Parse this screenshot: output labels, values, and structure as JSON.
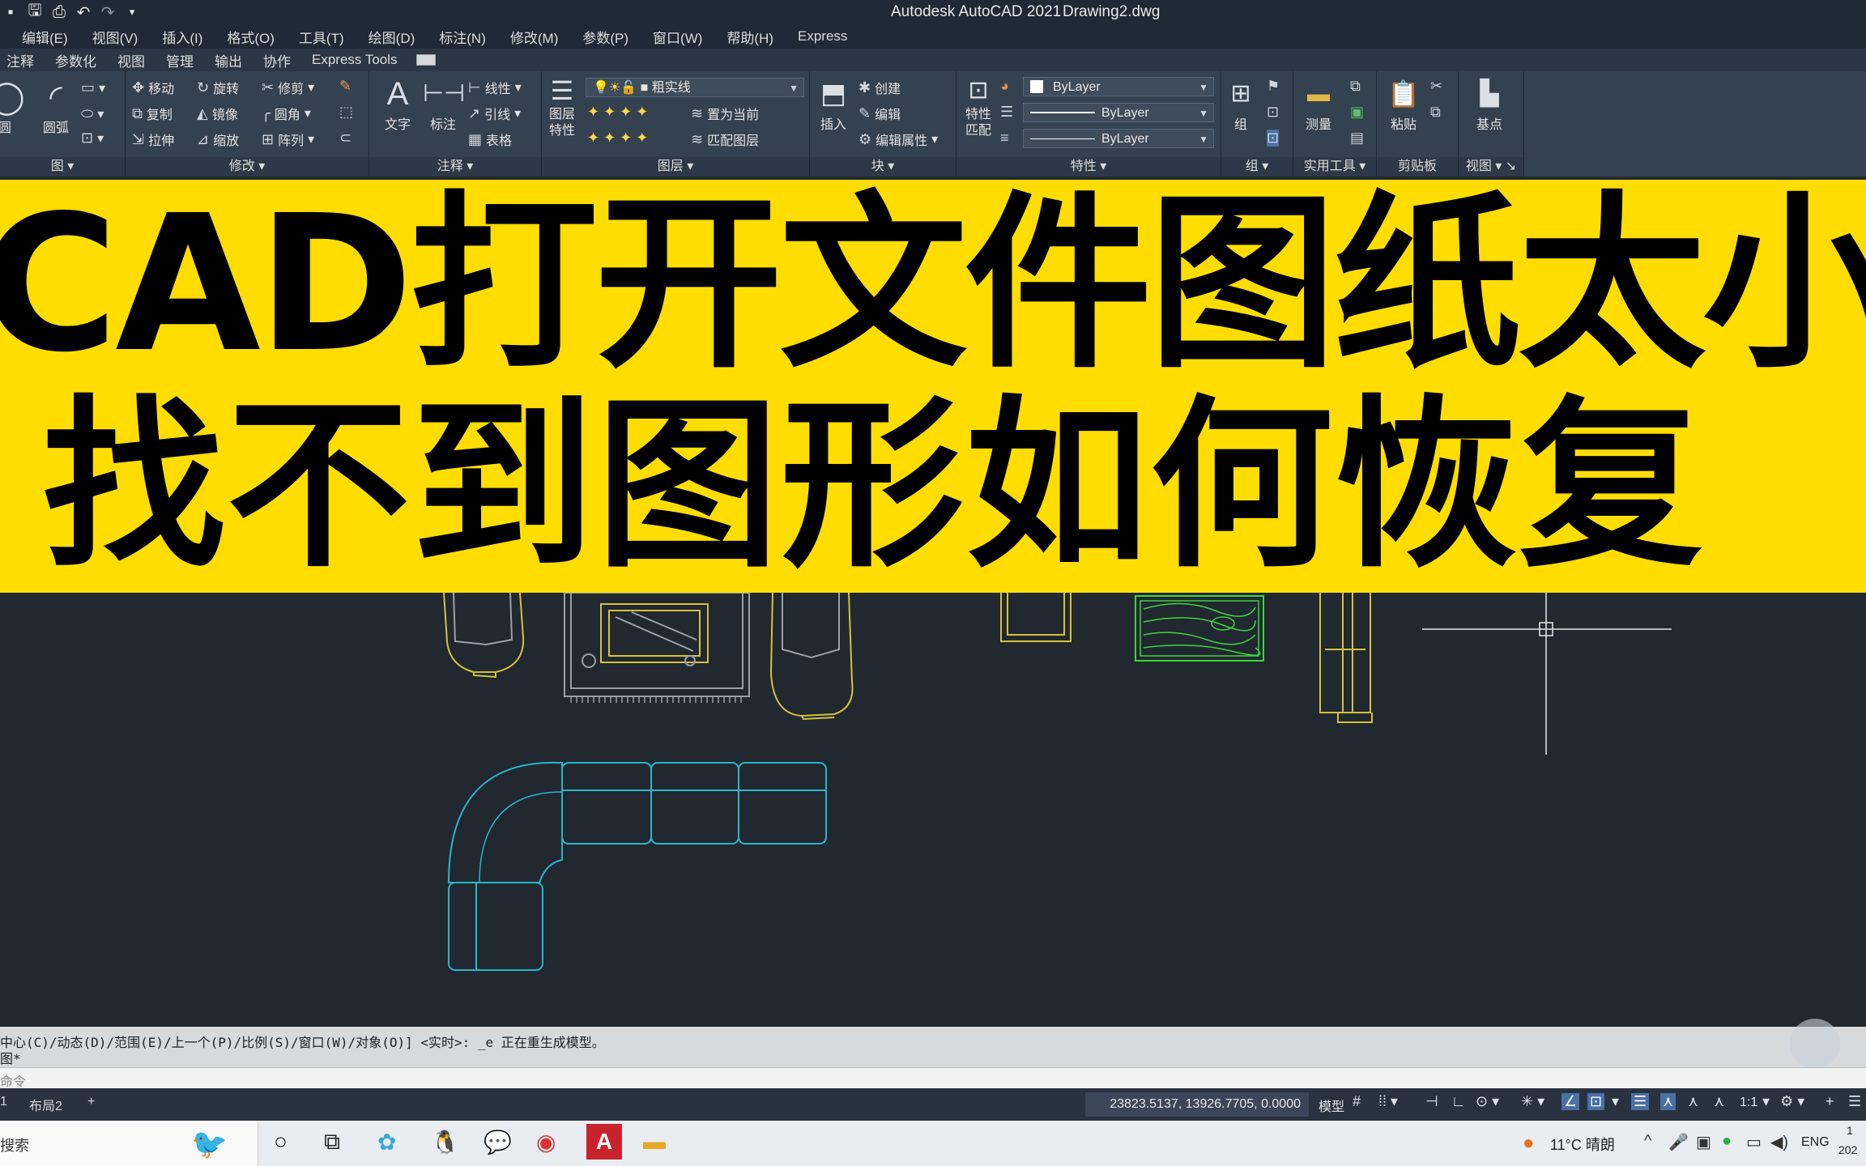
{
  "titlebar": {
    "app": "Autodesk AutoCAD 2021",
    "file": "Drawing2.dwg"
  },
  "qat_icons": [
    "file-save-icon",
    "save-as-icon",
    "print-icon",
    "undo-icon",
    "redo-icon",
    "dropdown-icon"
  ],
  "menu": [
    "编辑(E)",
    "视图(V)",
    "插入(I)",
    "格式(O)",
    "工具(T)",
    "绘图(D)",
    "标注(N)",
    "修改(M)",
    "参数(P)",
    "窗口(W)",
    "帮助(H)",
    "Express"
  ],
  "ribbon_tabs": [
    "注释",
    "参数化",
    "视图",
    "管理",
    "输出",
    "协作",
    "Express Tools"
  ],
  "panels": {
    "draw": {
      "title": "图",
      "circle": "圆",
      "arc": "圆弧"
    },
    "modify": {
      "title": "修改",
      "move": "移动",
      "rotate": "旋转",
      "trim": "修剪",
      "copy": "复制",
      "mirror": "镜像",
      "fillet": "圆角",
      "stretch": "拉伸",
      "scale": "缩放",
      "array": "阵列"
    },
    "annotation": {
      "title": "注释",
      "text": "文字",
      "dimension": "标注",
      "linear": "线性",
      "leader": "引线",
      "table": "表格"
    },
    "layers": {
      "title": "图层",
      "properties": "图层\n特性",
      "current_layer": "粗实线",
      "set_current": "置为当前",
      "match_layer": "匹配图层"
    },
    "block": {
      "title": "块",
      "insert": "插入",
      "create": "创建",
      "edit": "编辑",
      "edit_attr": "编辑属性"
    },
    "properties": {
      "title": "特性",
      "match": "特性\n匹配",
      "color": "ByLayer",
      "linetype": "ByLayer",
      "lineweight": "ByLayer"
    },
    "groups": {
      "title": "组",
      "group": "组"
    },
    "utilities": {
      "title": "实用工具",
      "measure": "测量"
    },
    "clipboard": {
      "title": "剪贴板",
      "paste": "粘贴"
    },
    "view": {
      "title": "视图",
      "basepoint": "基点"
    }
  },
  "banner": {
    "line1": "CAD打开文件图纸太小",
    "line2": "找不到图形如何恢复"
  },
  "command": {
    "history1": "中心(C)/动态(D)/范围(E)/上一个(P)/比例(S)/窗口(W)/对象(O)] <实时>: _e 正在重生成模型。",
    "history2": "图*",
    "input_placeholder": "命令"
  },
  "layout_tabs": [
    "1",
    "布局2",
    "+"
  ],
  "status": {
    "coords": "23823.5137, 13926.7705, 0.0000",
    "model": "模型",
    "scale": "1:1"
  },
  "taskbar": {
    "search": "搜索",
    "weather": "11°C 晴朗",
    "lang": "ENG",
    "clock_top": "1",
    "clock_bottom": "202"
  },
  "colors": {
    "banner": "#ffdd00",
    "canvas": "#212830",
    "sofa": "#29b6c8",
    "furniture": "#d4c23a",
    "wood": "#3fd33f"
  }
}
